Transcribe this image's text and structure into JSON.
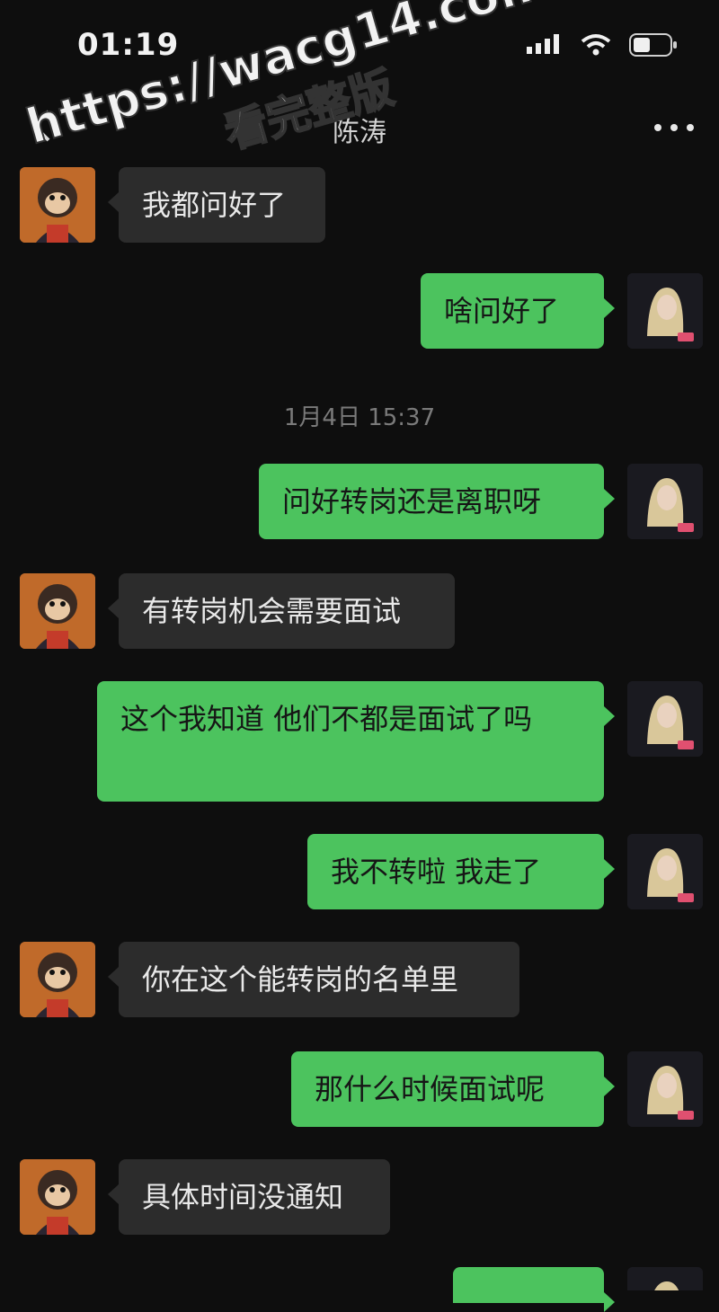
{
  "status_bar": {
    "time": "01:19"
  },
  "header": {
    "title": "陈涛"
  },
  "watermark": {
    "line1": "https://wacg14.com",
    "line2": "看完整版"
  },
  "timestamp": "1月4日 15:37",
  "messages": [
    {
      "side": "in",
      "text": "我都问好了"
    },
    {
      "side": "out",
      "text": "啥问好了"
    },
    {
      "side": "out",
      "text": "问好转岗还是离职呀"
    },
    {
      "side": "in",
      "text": "有转岗机会需要面试"
    },
    {
      "side": "out",
      "text": "这个我知道 他们不都是面试了吗"
    },
    {
      "side": "out",
      "text": "我不转啦 我走了"
    },
    {
      "side": "in",
      "text": "你在这个能转岗的名单里"
    },
    {
      "side": "out",
      "text": "那什么时候面试呢"
    },
    {
      "side": "in",
      "text": "具体时间没通知"
    },
    {
      "side": "out",
      "text": ""
    }
  ],
  "colors": {
    "outgoing_bubble": "#4cc35e",
    "incoming_bubble": "#2c2c2c",
    "background": "#0e0e0e"
  }
}
